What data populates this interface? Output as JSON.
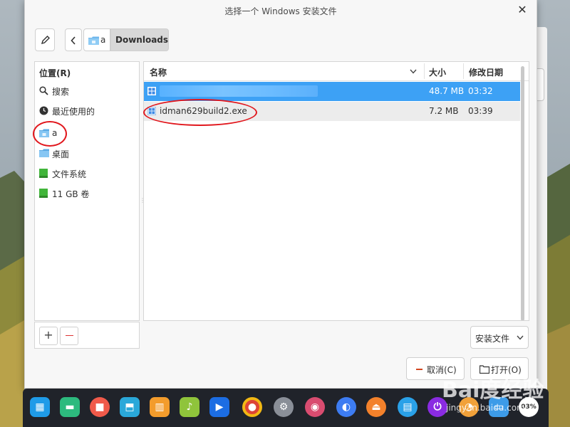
{
  "dialog": {
    "title": "选择一个 Windows 安装文件",
    "close_glyph": "✕"
  },
  "breadcrumb": {
    "parent_label": "a",
    "current_label": "Downloads"
  },
  "sidebar": {
    "header": "位置(R)",
    "items": [
      {
        "label": "搜索",
        "icon": "search-icon"
      },
      {
        "label": "最近使用的",
        "icon": "clock-icon"
      },
      {
        "label": "a",
        "icon": "home-folder-icon"
      },
      {
        "label": "桌面",
        "icon": "desktop-folder-icon"
      },
      {
        "label": "文件系统",
        "icon": "drive-icon"
      },
      {
        "label": "11 GB 卷",
        "icon": "drive-icon"
      }
    ],
    "add_glyph": "+"
  },
  "filelist": {
    "columns": [
      "名称",
      "大小",
      "修改日期"
    ],
    "rows": [
      {
        "name": "",
        "size": "48.7 MB",
        "date": "03:32",
        "selected": true
      },
      {
        "name": "idman629build2.exe",
        "size": "7.2 MB",
        "date": "03:39",
        "selected": false
      }
    ]
  },
  "filter": {
    "value": "安装文件"
  },
  "actions": {
    "cancel_label": "取消(C)",
    "open_label": "打开(O)"
  },
  "colors": {
    "selection": "#3da1f5",
    "annotation": "#e1171d",
    "taskbar": "#20232a"
  },
  "taskbar": {
    "apps": [
      {
        "icon": "launcher-icon",
        "color": "#1f9be8"
      },
      {
        "icon": "terminal-icon",
        "color": "#2dba7e"
      },
      {
        "icon": "screen-recorder-icon",
        "color": "#f05a4a"
      },
      {
        "icon": "app-store-icon",
        "color": "#2aa8d9"
      },
      {
        "icon": "archive-icon",
        "color": "#f39c2c"
      },
      {
        "icon": "music-icon",
        "color": "#8fc43b"
      },
      {
        "icon": "video-icon",
        "color": "#1c6de3"
      },
      {
        "icon": "chrome-icon",
        "color": "#dd4436"
      },
      {
        "icon": "settings-icon",
        "color": "#8a8f98"
      },
      {
        "icon": "capture-icon",
        "color": "#d94c70"
      },
      {
        "icon": "browser-icon",
        "color": "#3d7cf2"
      },
      {
        "icon": "eject-icon",
        "color": "#f3812b"
      },
      {
        "icon": "keyboard-icon",
        "color": "#2aa1e8"
      },
      {
        "icon": "power-icon",
        "color": "#8a2be2"
      },
      {
        "icon": "clock-widget-icon",
        "color": "#f1a13a"
      },
      {
        "icon": "file-manager-icon",
        "color": "#3d9be8"
      },
      {
        "icon": "system-monitor-icon",
        "color": "#ffffff"
      },
      {
        "icon": "trash-icon",
        "color": "#9aba4c"
      }
    ],
    "monitor_text": "03%"
  },
  "watermark": {
    "text": "Bai度经验",
    "sub": "jingyan.baidu.com"
  }
}
